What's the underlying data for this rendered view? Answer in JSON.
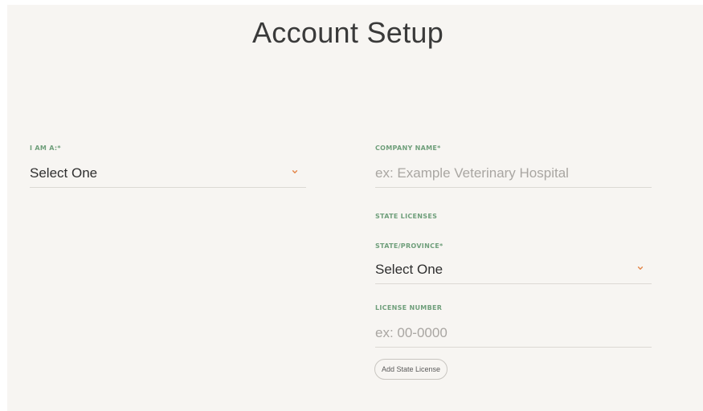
{
  "page": {
    "title": "Account Setup"
  },
  "form": {
    "role": {
      "label": "I AM A:*",
      "value": "Select One"
    },
    "company": {
      "label": "COMPANY NAME*",
      "placeholder": "ex: Example Veterinary Hospital"
    },
    "state_licenses": {
      "heading": "STATE LICENSES",
      "state": {
        "label": "STATE/PROVINCE*",
        "value": "Select One"
      },
      "license_number": {
        "label": "LICENSE NUMBER",
        "placeholder": "ex: 00-0000"
      },
      "add_button_label": "Add State License"
    }
  },
  "colors": {
    "label_green": "#6f9f7b",
    "chevron_orange": "#e4874a",
    "background": "#f7f5f2"
  },
  "icons": {
    "dropdown": "chevron-down-icon"
  }
}
